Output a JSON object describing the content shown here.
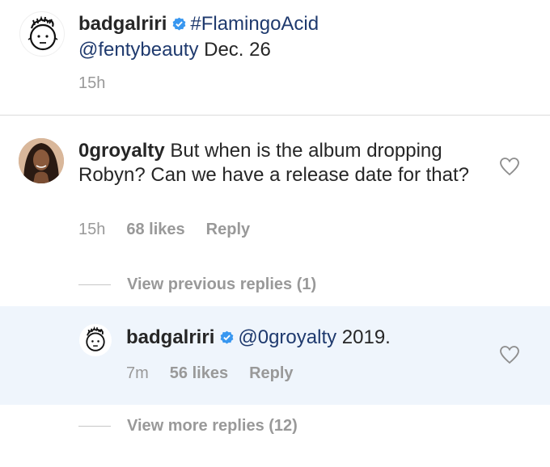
{
  "caption": {
    "username": "badgalriri",
    "hashtag": "#FlamingoAcid",
    "mention": "@fentybeauty",
    "text": "Dec. 26",
    "time": "15h"
  },
  "comment": {
    "username": "0groyalty",
    "text": "But when is the album dropping Robyn? Can we have a release date for that?",
    "time": "15h",
    "likes": "68 likes",
    "reply_label": "Reply",
    "view_previous": "View previous replies (1)"
  },
  "reply": {
    "username": "badgalriri",
    "mention": "@0groyalty",
    "text": "2019.",
    "time": "7m",
    "likes": "56 likes",
    "reply_label": "Reply"
  },
  "view_more": "View more replies (12)",
  "colors": {
    "verified": "#3897f0",
    "link": "#1f3a6e",
    "meta": "#999999",
    "highlight": "#eff5fc"
  },
  "icons": [
    "verified-badge-icon",
    "heart-icon"
  ]
}
